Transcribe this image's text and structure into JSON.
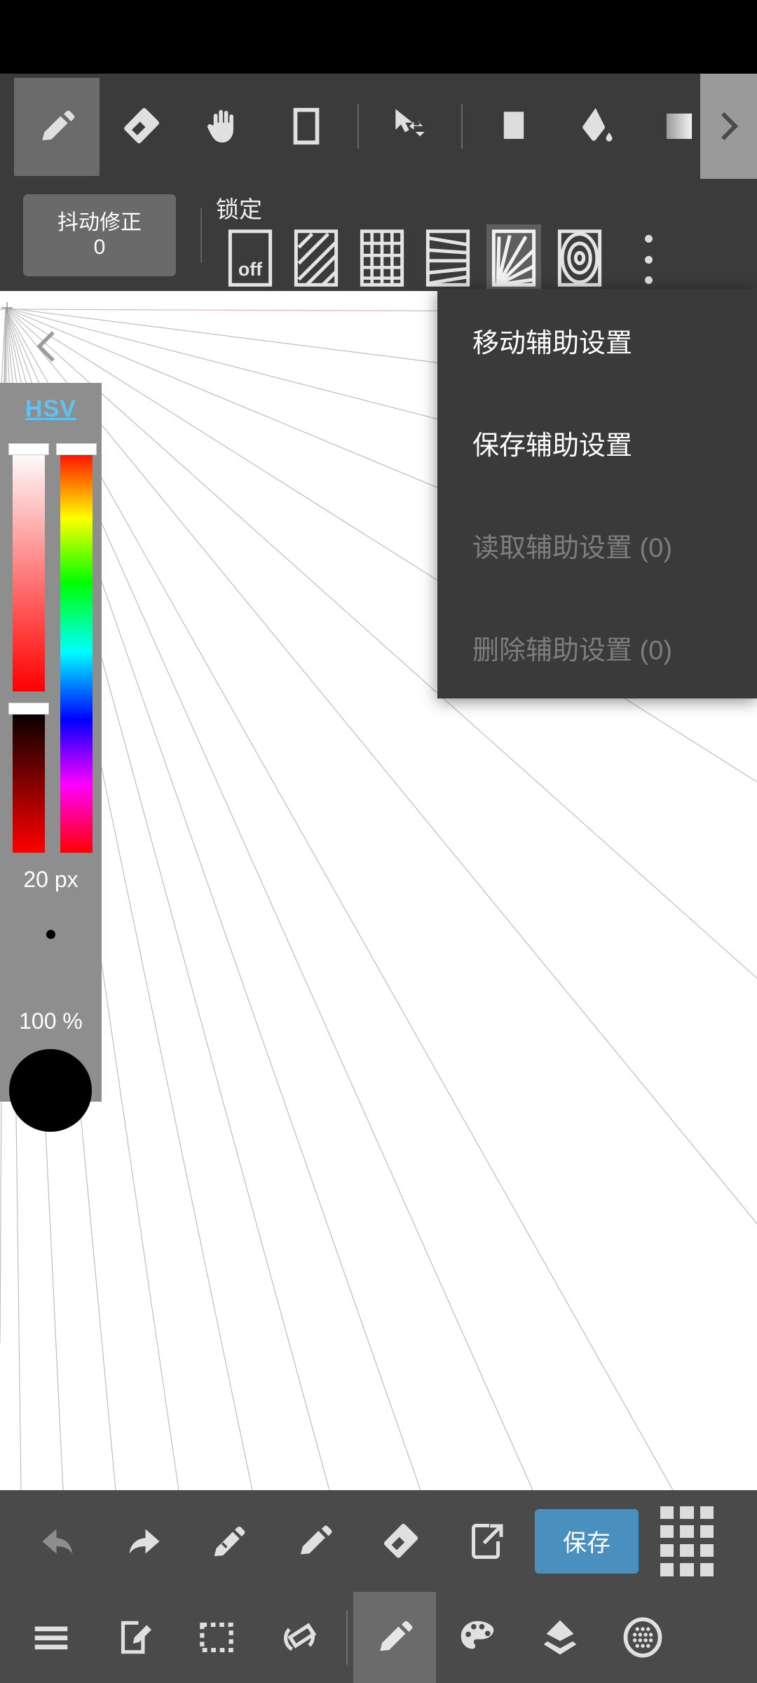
{
  "app": {
    "name": "ibisPaint",
    "theme_bg": "#3b3b3b",
    "accent": "#4a90bf"
  },
  "toolbar": {
    "tools": [
      {
        "name": "pencil-tool",
        "icon": "pencil-icon",
        "selected": true
      },
      {
        "name": "eraser-tool",
        "icon": "eraser-icon",
        "selected": false
      },
      {
        "name": "hand-tool",
        "icon": "hand-icon",
        "selected": false
      },
      {
        "name": "frame-tool",
        "icon": "rectangle-frame-icon",
        "selected": false
      },
      {
        "name": "move-tool",
        "icon": "cursor-move-icon",
        "selected": false
      },
      {
        "name": "shape-tool",
        "icon": "filled-square-icon",
        "selected": false
      },
      {
        "name": "bucket-tool",
        "icon": "paint-bucket-icon",
        "selected": false
      },
      {
        "name": "gradient-tool",
        "icon": "gradient-square-icon",
        "selected": false
      }
    ],
    "expand_icon": "chevron-right-icon"
  },
  "options": {
    "stabilizer": {
      "label": "抖动修正",
      "value": "0"
    },
    "lock_label": "锁定",
    "rulers": [
      {
        "name": "ruler-off",
        "label": "off",
        "icon": "ruler-off-icon",
        "selected": false
      },
      {
        "name": "ruler-parallel",
        "label": "",
        "icon": "ruler-parallel-icon",
        "selected": false
      },
      {
        "name": "ruler-grid",
        "label": "",
        "icon": "ruler-grid-icon",
        "selected": false
      },
      {
        "name": "ruler-perspective",
        "label": "",
        "icon": "ruler-perspective-icon",
        "selected": false
      },
      {
        "name": "ruler-radial",
        "label": "",
        "icon": "ruler-radial-icon",
        "selected": true
      },
      {
        "name": "ruler-concentric",
        "label": "",
        "icon": "ruler-concentric-icon",
        "selected": false
      }
    ],
    "overflow_icon": "more-vertical-icon"
  },
  "menu": {
    "items": [
      {
        "label": "移动辅助设置",
        "disabled": false
      },
      {
        "label": "保存辅助设置",
        "disabled": false
      },
      {
        "label": "读取辅助设置 (0)",
        "disabled": true
      },
      {
        "label": "删除辅助设置 (0)",
        "disabled": true
      }
    ]
  },
  "canvas": {
    "collapse_icon": "chevron-double-left-icon",
    "guide_type": "radial-perspective",
    "guide_color": "#b0b0b0",
    "background": "#ffffff"
  },
  "color_panel": {
    "mode_label": "HSV",
    "mode_color": "#5ec2f2",
    "brush_size": "20 px",
    "opacity": "100 %",
    "current_color": "#000000",
    "hue_color": "#ff0000"
  },
  "action_bar": {
    "buttons": [
      {
        "name": "undo-button",
        "icon": "undo-icon",
        "dimmed": true
      },
      {
        "name": "redo-button",
        "icon": "redo-icon",
        "dimmed": false
      },
      {
        "name": "eyedropper-button",
        "icon": "eyedropper-icon",
        "dimmed": false
      },
      {
        "name": "pencil-button",
        "icon": "pencil-icon",
        "dimmed": false
      },
      {
        "name": "eraser-button",
        "icon": "eraser-icon",
        "dimmed": false
      },
      {
        "name": "export-button",
        "icon": "export-icon",
        "dimmed": false
      }
    ],
    "save_label": "保存",
    "apps_icon": "grid-dots-icon"
  },
  "nav_bar": {
    "items": [
      {
        "name": "nav-menu",
        "icon": "hamburger-icon",
        "selected": false
      },
      {
        "name": "nav-document",
        "icon": "edit-document-icon",
        "selected": false
      },
      {
        "name": "nav-select",
        "icon": "marquee-select-icon",
        "selected": false
      },
      {
        "name": "nav-transform",
        "icon": "rotate-canvas-icon",
        "selected": false
      },
      {
        "name": "nav-brush",
        "icon": "pencil-icon",
        "selected": true
      },
      {
        "name": "nav-palette",
        "icon": "palette-icon",
        "selected": false
      },
      {
        "name": "nav-layers",
        "icon": "layers-icon",
        "selected": false
      },
      {
        "name": "nav-material",
        "icon": "texture-circle-icon",
        "selected": false
      }
    ]
  }
}
